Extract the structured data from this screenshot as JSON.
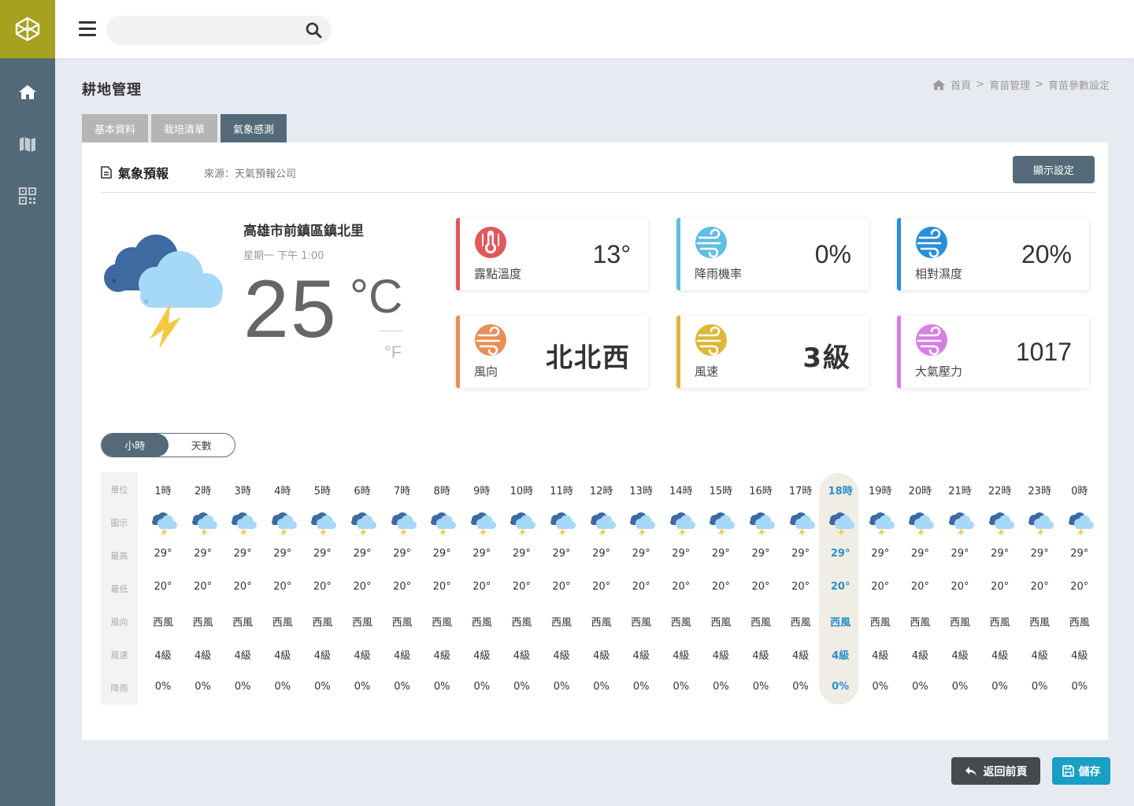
{
  "nav": {
    "search_placeholder": ""
  },
  "page": {
    "title": "耕地管理"
  },
  "breadcrumb": {
    "home": "首頁",
    "sep1": ">",
    "mid": "育苗管理",
    "sep2": ">",
    "current": "育苗參數設定"
  },
  "tabs": [
    {
      "label": "基本資料",
      "active": false
    },
    {
      "label": "栽培清單",
      "active": false
    },
    {
      "label": "氣象感測",
      "active": true
    }
  ],
  "card": {
    "title": "氣象預報",
    "source": "來源：天氣預報公司",
    "display_button": "顯示設定"
  },
  "current": {
    "location": "高雄市前鎮區鎮北里",
    "datetime": "星期一  下午 1:00",
    "temp": "25",
    "unit_c": "°C",
    "unit_f": "°F",
    "icon": "thunderstorm-cloud-icon"
  },
  "stats": [
    {
      "label": "露點溫度",
      "value": "13°",
      "color": "#e0585b",
      "icon": "thermometer-icon"
    },
    {
      "label": "降雨機率",
      "value": "0%",
      "color": "#62bde0",
      "icon": "wind-icon"
    },
    {
      "label": "相對濕度",
      "value": "20%",
      "color": "#2a8fd8",
      "icon": "wind-icon"
    },
    {
      "label": "風向",
      "value": "北北西",
      "color": "#e98e56",
      "icon": "wind-icon"
    },
    {
      "label": "風速",
      "value": "3級",
      "color": "#dbb73a",
      "icon": "wind-icon"
    },
    {
      "label": "大氣壓力",
      "value": "1017",
      "color": "#d67fe0",
      "icon": "wind-icon"
    }
  ],
  "toggle": {
    "hours": "小時",
    "days": "天數",
    "active": "hours"
  },
  "hourly": {
    "row_labels": [
      "單位",
      "圖示",
      "最高",
      "最低",
      "風向",
      "風速",
      "降雨"
    ],
    "highlight_index": 17,
    "columns": [
      {
        "hour": "1時",
        "high": "29°",
        "low": "20°",
        "wind_dir": "西風",
        "wind_speed": "4級",
        "rain": "0%"
      },
      {
        "hour": "2時",
        "high": "29°",
        "low": "20°",
        "wind_dir": "西風",
        "wind_speed": "4級",
        "rain": "0%"
      },
      {
        "hour": "3時",
        "high": "29°",
        "low": "20°",
        "wind_dir": "西風",
        "wind_speed": "4級",
        "rain": "0%"
      },
      {
        "hour": "4時",
        "high": "29°",
        "low": "20°",
        "wind_dir": "西風",
        "wind_speed": "4級",
        "rain": "0%"
      },
      {
        "hour": "5時",
        "high": "29°",
        "low": "20°",
        "wind_dir": "西風",
        "wind_speed": "4級",
        "rain": "0%"
      },
      {
        "hour": "6時",
        "high": "29°",
        "low": "20°",
        "wind_dir": "西風",
        "wind_speed": "4級",
        "rain": "0%"
      },
      {
        "hour": "7時",
        "high": "29°",
        "low": "20°",
        "wind_dir": "西風",
        "wind_speed": "4級",
        "rain": "0%"
      },
      {
        "hour": "8時",
        "high": "29°",
        "low": "20°",
        "wind_dir": "西風",
        "wind_speed": "4級",
        "rain": "0%"
      },
      {
        "hour": "9時",
        "high": "29°",
        "low": "20°",
        "wind_dir": "西風",
        "wind_speed": "4級",
        "rain": "0%"
      },
      {
        "hour": "10時",
        "high": "29°",
        "low": "20°",
        "wind_dir": "西風",
        "wind_speed": "4級",
        "rain": "0%"
      },
      {
        "hour": "11時",
        "high": "29°",
        "low": "20°",
        "wind_dir": "西風",
        "wind_speed": "4級",
        "rain": "0%"
      },
      {
        "hour": "12時",
        "high": "29°",
        "low": "20°",
        "wind_dir": "西風",
        "wind_speed": "4級",
        "rain": "0%"
      },
      {
        "hour": "13時",
        "high": "29°",
        "low": "20°",
        "wind_dir": "西風",
        "wind_speed": "4級",
        "rain": "0%"
      },
      {
        "hour": "14時",
        "high": "29°",
        "low": "20°",
        "wind_dir": "西風",
        "wind_speed": "4級",
        "rain": "0%"
      },
      {
        "hour": "15時",
        "high": "29°",
        "low": "20°",
        "wind_dir": "西風",
        "wind_speed": "4級",
        "rain": "0%"
      },
      {
        "hour": "16時",
        "high": "29°",
        "low": "20°",
        "wind_dir": "西風",
        "wind_speed": "4級",
        "rain": "0%"
      },
      {
        "hour": "17時",
        "high": "29°",
        "low": "20°",
        "wind_dir": "西風",
        "wind_speed": "4級",
        "rain": "0%"
      },
      {
        "hour": "18時",
        "high": "29°",
        "low": "20°",
        "wind_dir": "西風",
        "wind_speed": "4級",
        "rain": "0%"
      },
      {
        "hour": "19時",
        "high": "29°",
        "low": "20°",
        "wind_dir": "西風",
        "wind_speed": "4級",
        "rain": "0%"
      },
      {
        "hour": "20時",
        "high": "29°",
        "low": "20°",
        "wind_dir": "西風",
        "wind_speed": "4級",
        "rain": "0%"
      },
      {
        "hour": "21時",
        "high": "29°",
        "low": "20°",
        "wind_dir": "西風",
        "wind_speed": "4級",
        "rain": "0%"
      },
      {
        "hour": "22時",
        "high": "29°",
        "low": "20°",
        "wind_dir": "西風",
        "wind_speed": "4級",
        "rain": "0%"
      },
      {
        "hour": "23時",
        "high": "29°",
        "low": "20°",
        "wind_dir": "西風",
        "wind_speed": "4級",
        "rain": "0%"
      },
      {
        "hour": "0時",
        "high": "29°",
        "low": "20°",
        "wind_dir": "西風",
        "wind_speed": "4級",
        "rain": "0%"
      }
    ]
  },
  "footer": {
    "back_label": "返回前頁",
    "save_label": "儲存"
  },
  "colors": {
    "sidebar": "#526a78",
    "logo_bg": "#a6a21f",
    "accent": "#546a78",
    "highlight_text": "#2a8fc8",
    "save": "#1a9ec4"
  }
}
